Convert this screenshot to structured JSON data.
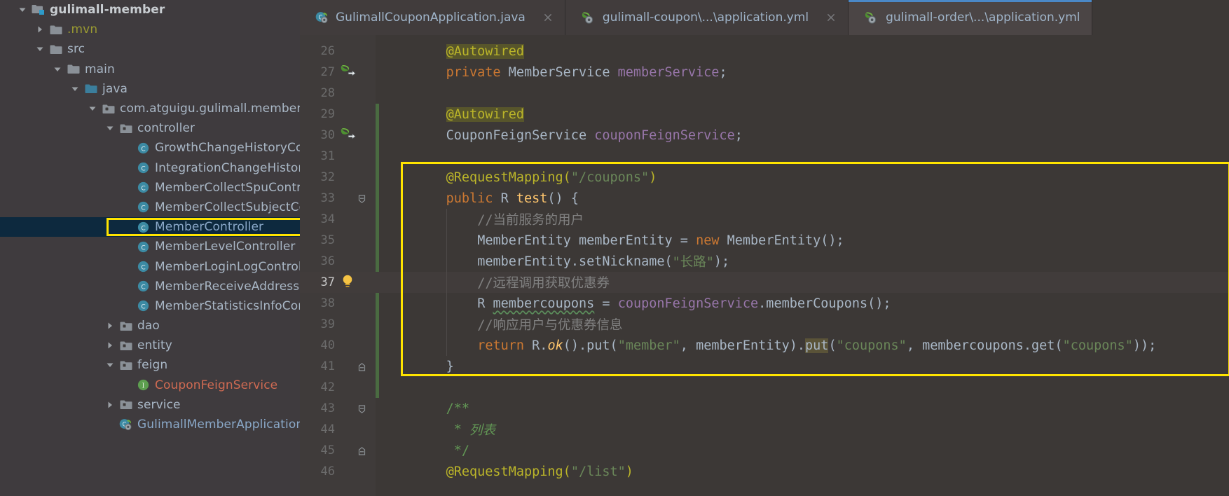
{
  "theme": {
    "tree_bg": "#3f3b3e",
    "editor_bg": "#3c3836",
    "gutter_bg": "#3f3b3a",
    "selection_bg": "#0d293e",
    "highlight_box": "#ffe400",
    "tab_active_accent": "#4a88c7",
    "caret_line": "#413c3b",
    "change_stripe": "#4a6b41"
  },
  "project_tree": {
    "items": [
      {
        "label": "gulimall-member",
        "indent": 0,
        "arrow": "down",
        "icon": "module-folder-icon",
        "style": "bold"
      },
      {
        "label": ".mvn",
        "indent": 1,
        "arrow": "right",
        "icon": "folder-icon",
        "style": "olive"
      },
      {
        "label": "src",
        "indent": 1,
        "arrow": "down",
        "icon": "folder-icon",
        "style": "gray"
      },
      {
        "label": "main",
        "indent": 2,
        "arrow": "down",
        "icon": "folder-icon",
        "style": "gray"
      },
      {
        "label": "java",
        "indent": 3,
        "arrow": "down",
        "icon": "source-root-folder-icon",
        "style": "gray"
      },
      {
        "label": "com.atguigu.gulimall.member",
        "indent": 4,
        "arrow": "down",
        "icon": "package-icon",
        "style": "gray"
      },
      {
        "label": "controller",
        "indent": 5,
        "arrow": "down",
        "icon": "package-icon",
        "style": "gray"
      },
      {
        "label": "GrowthChangeHistoryContr",
        "indent": 6,
        "arrow": "none",
        "icon": "java-class-icon",
        "style": "gray"
      },
      {
        "label": "IntegrationChangeHistoryC",
        "indent": 6,
        "arrow": "none",
        "icon": "java-class-icon",
        "style": "gray"
      },
      {
        "label": "MemberCollectSpuControlle",
        "indent": 6,
        "arrow": "none",
        "icon": "java-class-icon",
        "style": "gray"
      },
      {
        "label": "MemberCollectSubjectCont",
        "indent": 6,
        "arrow": "none",
        "icon": "java-class-icon",
        "style": "gray"
      },
      {
        "label": "MemberController",
        "indent": 6,
        "arrow": "none",
        "icon": "java-class-icon",
        "style": "blue",
        "selected": true,
        "boxed": true
      },
      {
        "label": "MemberLevelController",
        "indent": 6,
        "arrow": "none",
        "icon": "java-class-icon",
        "style": "gray"
      },
      {
        "label": "MemberLoginLogController",
        "indent": 6,
        "arrow": "none",
        "icon": "java-class-icon",
        "style": "gray"
      },
      {
        "label": "MemberReceiveAddressCor",
        "indent": 6,
        "arrow": "none",
        "icon": "java-class-icon",
        "style": "gray"
      },
      {
        "label": "MemberStatisticsInfoContro",
        "indent": 6,
        "arrow": "none",
        "icon": "java-class-icon",
        "style": "gray"
      },
      {
        "label": "dao",
        "indent": 5,
        "arrow": "right",
        "icon": "package-icon",
        "style": "gray"
      },
      {
        "label": "entity",
        "indent": 5,
        "arrow": "right",
        "icon": "package-icon",
        "style": "gray"
      },
      {
        "label": "feign",
        "indent": 5,
        "arrow": "down",
        "icon": "package-icon",
        "style": "gray"
      },
      {
        "label": "CouponFeignService",
        "indent": 6,
        "arrow": "none",
        "icon": "java-interface-icon",
        "style": "red"
      },
      {
        "label": "service",
        "indent": 5,
        "arrow": "right",
        "icon": "package-icon",
        "style": "gray"
      },
      {
        "label": "GulimallMemberApplication",
        "indent": 5,
        "arrow": "none",
        "icon": "spring-boot-class-icon",
        "style": "blue"
      }
    ]
  },
  "editor": {
    "tabs": [
      {
        "label": "GulimallCouponApplication.java",
        "icon": "spring-boot-class-icon",
        "active": false,
        "closable": true
      },
      {
        "label": "gulimall-coupon\\...\\application.yml",
        "icon": "spring-yaml-icon",
        "active": false,
        "closable": true
      },
      {
        "label": "gulimall-order\\...\\application.yml",
        "icon": "spring-yaml-icon",
        "active": true,
        "closable": false
      }
    ],
    "first_line_number": 26,
    "current_line": 37,
    "gutter_marks": {
      "27": "spring-bean-navigate-icon",
      "30": "spring-bean-navigate-icon",
      "37": "intention-bulb-icon"
    },
    "fold_marks": {
      "33": "fold-collapse-icon",
      "41": "fold-end-icon",
      "43": "fold-collapse-icon",
      "45": "fold-end-icon"
    },
    "lines": [
      {
        "n": 26,
        "tokens": [
          {
            "t": "@Autowired",
            "c": "t-annobg",
            "indent": 4
          }
        ]
      },
      {
        "n": 27,
        "tokens": [
          {
            "t": "private ",
            "c": "t-kw",
            "indent": 4
          },
          {
            "t": "MemberService ",
            "c": "t-type"
          },
          {
            "t": "memberService",
            "c": "t-field"
          },
          {
            "t": ";",
            "c": "t-plain"
          }
        ]
      },
      {
        "n": 28,
        "tokens": []
      },
      {
        "n": 29,
        "tokens": [
          {
            "t": "@Autowired",
            "c": "t-annobg",
            "indent": 4
          }
        ]
      },
      {
        "n": 30,
        "tokens": [
          {
            "t": "CouponFeignService ",
            "c": "t-type",
            "indent": 4
          },
          {
            "t": "couponFeignService",
            "c": "t-field"
          },
          {
            "t": ";",
            "c": "t-plain"
          }
        ]
      },
      {
        "n": 31,
        "tokens": []
      },
      {
        "n": 32,
        "tokens": [
          {
            "t": "@RequestMapping(",
            "c": "t-anno",
            "indent": 4
          },
          {
            "t": "\"/coupons\"",
            "c": "t-str"
          },
          {
            "t": ")",
            "c": "t-anno"
          }
        ]
      },
      {
        "n": 33,
        "tokens": [
          {
            "t": "public ",
            "c": "t-kw",
            "indent": 4
          },
          {
            "t": "R ",
            "c": "t-type"
          },
          {
            "t": "test",
            "c": "t-meth"
          },
          {
            "t": "() {",
            "c": "t-plain"
          }
        ]
      },
      {
        "n": 34,
        "tokens": [
          {
            "t": "//当前服务的用户",
            "c": "t-cmt",
            "indent": 8
          }
        ]
      },
      {
        "n": 35,
        "tokens": [
          {
            "t": "MemberEntity memberEntity = ",
            "c": "t-type",
            "indent": 8
          },
          {
            "t": "new ",
            "c": "t-kw"
          },
          {
            "t": "MemberEntity();",
            "c": "t-type"
          }
        ]
      },
      {
        "n": 36,
        "tokens": [
          {
            "t": "memberEntity.setNickname(",
            "c": "t-type",
            "indent": 8
          },
          {
            "t": "\"长路\"",
            "c": "t-str"
          },
          {
            "t": ");",
            "c": "t-plain"
          }
        ]
      },
      {
        "n": 37,
        "tokens": [
          {
            "t": "//远程调用获取优惠券",
            "c": "t-cmt",
            "indent": 8
          }
        ]
      },
      {
        "n": 38,
        "tokens": [
          {
            "t": "R ",
            "c": "t-type",
            "indent": 8
          },
          {
            "t": "membercoupons",
            "c": "t-warn"
          },
          {
            "t": " = ",
            "c": "t-plain"
          },
          {
            "t": "couponFeignService",
            "c": "t-field"
          },
          {
            "t": ".memberCoupons();",
            "c": "t-type"
          }
        ]
      },
      {
        "n": 39,
        "tokens": [
          {
            "t": "//响应用户与优惠券信息",
            "c": "t-cmt",
            "indent": 8
          }
        ]
      },
      {
        "n": 40,
        "tokens": [
          {
            "t": "return ",
            "c": "t-kw",
            "indent": 8
          },
          {
            "t": "R.",
            "c": "t-type"
          },
          {
            "t": "ok",
            "c": "t-methit"
          },
          {
            "t": "().put(",
            "c": "t-type"
          },
          {
            "t": "\"member\"",
            "c": "t-str"
          },
          {
            "t": ", memberEntity).",
            "c": "t-type"
          },
          {
            "t": "put",
            "c": "t-hl"
          },
          {
            "t": "(",
            "c": "t-type"
          },
          {
            "t": "\"coupons\"",
            "c": "t-str"
          },
          {
            "t": ", membercoupons.get(",
            "c": "t-type"
          },
          {
            "t": "\"coupons\"",
            "c": "t-str"
          },
          {
            "t": "));",
            "c": "t-type"
          }
        ]
      },
      {
        "n": 41,
        "tokens": [
          {
            "t": "}",
            "c": "t-plain",
            "indent": 4
          }
        ]
      },
      {
        "n": 42,
        "tokens": []
      },
      {
        "n": 43,
        "tokens": [
          {
            "t": "/**",
            "c": "t-doc",
            "indent": 4
          }
        ]
      },
      {
        "n": 44,
        "tokens": [
          {
            "t": " * ",
            "c": "t-doc",
            "indent": 4
          },
          {
            "t": "列表",
            "c": "t-docit"
          }
        ]
      },
      {
        "n": 45,
        "tokens": [
          {
            "t": " */",
            "c": "t-doc",
            "indent": 4
          }
        ]
      },
      {
        "n": 46,
        "tokens": [
          {
            "t": "@RequestMapping(",
            "c": "t-anno",
            "indent": 4
          },
          {
            "t": "\"/list\"",
            "c": "t-str"
          },
          {
            "t": ")",
            "c": "t-anno"
          }
        ]
      }
    ]
  },
  "annotations": {
    "code_box": {
      "label": "highlight-rectangle-method",
      "color": "#ffe400"
    },
    "tree_box": {
      "label": "highlight-rectangle-membercontroller",
      "color": "#ffe400"
    }
  }
}
